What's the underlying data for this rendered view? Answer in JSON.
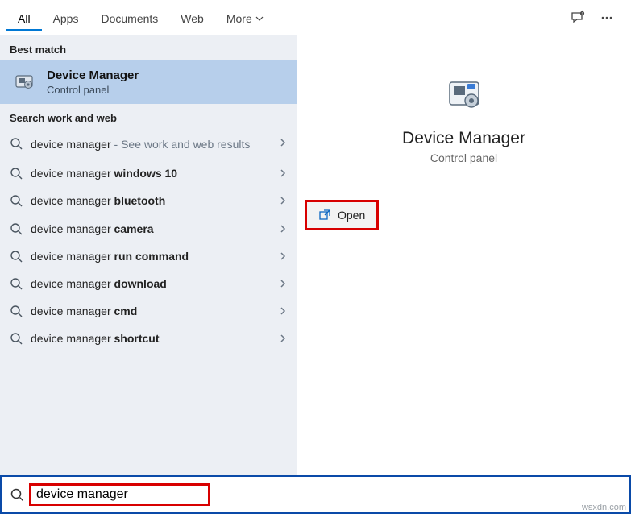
{
  "tabs": {
    "all": "All",
    "apps": "Apps",
    "documents": "Documents",
    "web": "Web",
    "more": "More"
  },
  "left": {
    "best_match_header": "Best match",
    "best_match": {
      "title": "Device Manager",
      "subtitle": "Control panel"
    },
    "work_web_header": "Search work and web",
    "suggestions": [
      {
        "pre": "device manager",
        "bold": "",
        "post": " - See work and web results"
      },
      {
        "pre": "device manager ",
        "bold": "windows 10",
        "post": ""
      },
      {
        "pre": "device manager ",
        "bold": "bluetooth",
        "post": ""
      },
      {
        "pre": "device manager ",
        "bold": "camera",
        "post": ""
      },
      {
        "pre": "device manager ",
        "bold": "run command",
        "post": ""
      },
      {
        "pre": "device manager ",
        "bold": "download",
        "post": ""
      },
      {
        "pre": "device manager ",
        "bold": "cmd",
        "post": ""
      },
      {
        "pre": "device manager ",
        "bold": "shortcut",
        "post": ""
      }
    ]
  },
  "right": {
    "title": "Device Manager",
    "subtitle": "Control panel",
    "action_open": "Open"
  },
  "search": {
    "value": "device manager"
  },
  "watermark": "wsxdn.com"
}
